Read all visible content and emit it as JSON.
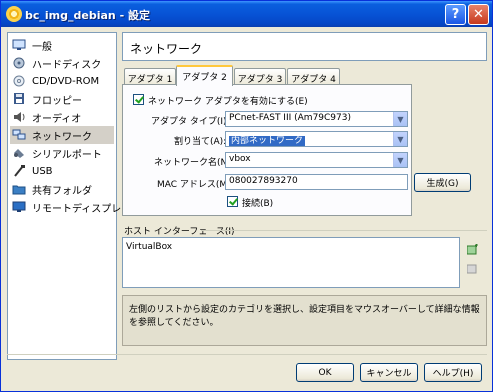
{
  "window": {
    "title": "bc_img_debian - 設定",
    "help_label": "?",
    "close_label": "✕"
  },
  "categories": [
    {
      "label": "一般",
      "icon": "monitor-icon"
    },
    {
      "label": "ハードディスク",
      "icon": "hard-disk-icon"
    },
    {
      "label": "CD/DVD-ROM",
      "icon": "cd-icon"
    },
    {
      "label": "フロッピー",
      "icon": "floppy-icon"
    },
    {
      "label": "オーディオ",
      "icon": "speaker-icon"
    },
    {
      "label": "ネットワーク",
      "icon": "network-icon",
      "selected": true
    },
    {
      "label": "シリアルポート",
      "icon": "serial-port-icon"
    },
    {
      "label": "USB",
      "icon": "usb-icon"
    },
    {
      "label": "共有フォルダ",
      "icon": "folder-icon"
    },
    {
      "label": "リモートディスプレイ",
      "icon": "remote-display-icon"
    }
  ],
  "page_title": "ネットワーク",
  "tabs": [
    {
      "label": "アダプタ 1"
    },
    {
      "label": "アダプタ 2",
      "active": true
    },
    {
      "label": "アダプタ 3"
    },
    {
      "label": "アダプタ 4"
    }
  ],
  "adapter": {
    "enable_label": "ネットワーク アダプタを有効にする(E)",
    "enable_checked": true,
    "type_label": "アダプタ タイプ(I):",
    "type_value": "PCnet-FAST III (Am79C973)",
    "attach_label": "割り当て(A):",
    "attach_value": "内部ネットワーク",
    "netname_label": "ネットワーク名(N):",
    "netname_value": "vbox",
    "mac_label": "MAC アドレス(M):",
    "mac_value": "080027893270",
    "generate_label": "生成(G)",
    "connected_label": "接続(B)",
    "connected_checked": true
  },
  "host_interface": {
    "section_label": "ホスト インターフェース(I)",
    "items": [
      "VirtualBox"
    ]
  },
  "description": "左側のリストから設定のカテゴリを選択し、設定項目をマウスオーバーして詳細な情報を参照してください。",
  "buttons": {
    "ok": "OK",
    "cancel": "キャンセル",
    "help": "ヘルプ(H)"
  },
  "colors": {
    "titlebar": "#0753d6",
    "selection": "#316ac5",
    "dialog_bg": "#ece9d8"
  }
}
